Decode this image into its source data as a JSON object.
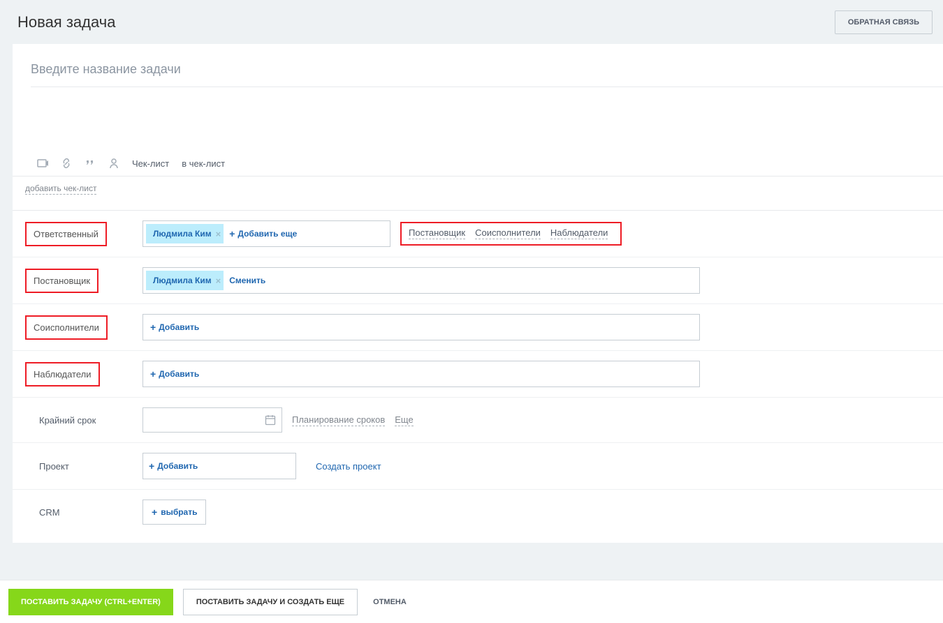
{
  "header": {
    "title": "Новая задача",
    "feedback": "ОБРАТНАЯ СВЯЗЬ"
  },
  "task": {
    "title_placeholder": "Введите название задачи"
  },
  "editor": {
    "checklist": "Чек-лист",
    "to_checklist": "в чек-лист",
    "add_checklist": "добавить чек-лист"
  },
  "roles": {
    "responsible_label": "Ответственный",
    "originator_label": "Постановщик",
    "participants_label": "Соисполнители",
    "observers_label": "Наблюдатели",
    "add_more": "Добавить еще",
    "add": "Добавить",
    "change": "Сменить",
    "responsible_user": "Людмила Ким",
    "originator_user": "Людмила Ким",
    "role_links": {
      "originator": "Постановщик",
      "participants": "Соисполнители",
      "observers": "Наблюдатели"
    }
  },
  "deadline": {
    "label": "Крайний срок",
    "planning": "Планирование сроков",
    "more": "Еще"
  },
  "project": {
    "label": "Проект",
    "add": "Добавить",
    "create": "Создать проект"
  },
  "crm": {
    "label": "CRM",
    "select": "выбрать"
  },
  "footer": {
    "submit": "ПОСТАВИТЬ ЗАДАЧУ (CTRL+ENTER)",
    "submit_more": "ПОСТАВИТЬ ЗАДАЧУ И СОЗДАТЬ ЕЩЕ",
    "cancel": "ОТМЕНА"
  }
}
